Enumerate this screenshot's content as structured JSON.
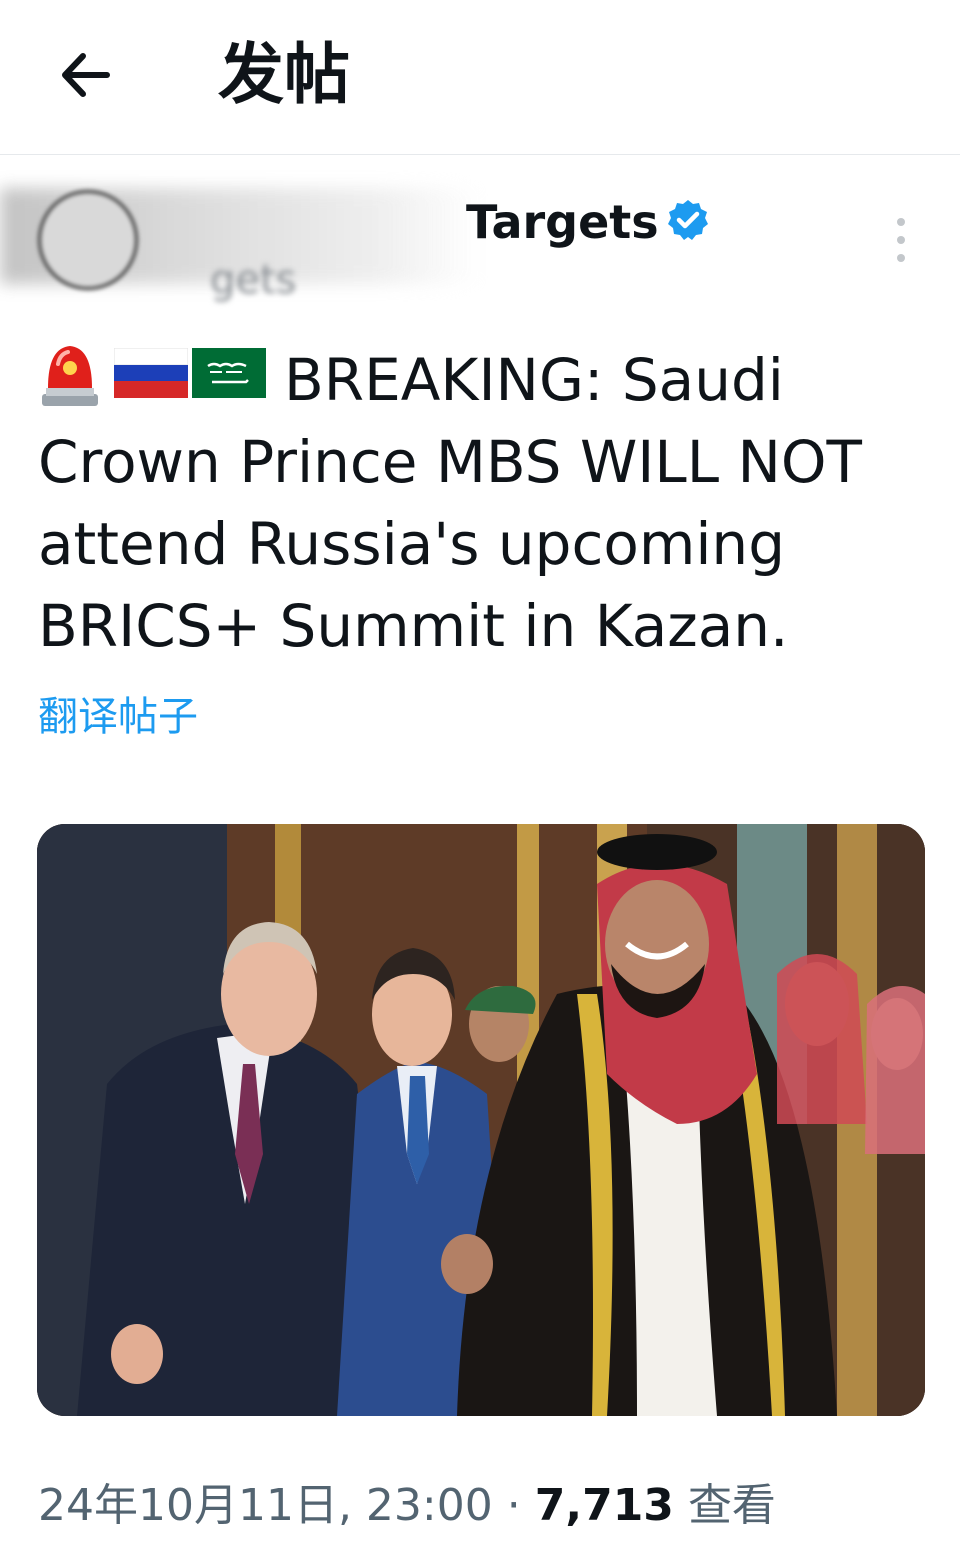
{
  "header": {
    "title": "发帖",
    "back_icon": "arrow-left-icon"
  },
  "author": {
    "name_visible": "Targets",
    "handle_visible": "gets",
    "verified_color": "#1d9bf0"
  },
  "tweet": {
    "emojis": [
      "police-light-icon",
      "russia-flag-icon",
      "saudi-flag-icon"
    ],
    "text": "BREAKING: Saudi Crown Prince MBS WILL NOT attend Russia's upcoming BRICS+ Summit in Kazan.",
    "translate_label": "翻译帖子"
  },
  "meta": {
    "timestamp": "24年10月11日, 23:00",
    "separator": "·",
    "views_count": "7,713",
    "views_label": "查看"
  },
  "colors": {
    "accent": "#1d9bf0",
    "text": "#0f1419",
    "muted": "#536471"
  }
}
